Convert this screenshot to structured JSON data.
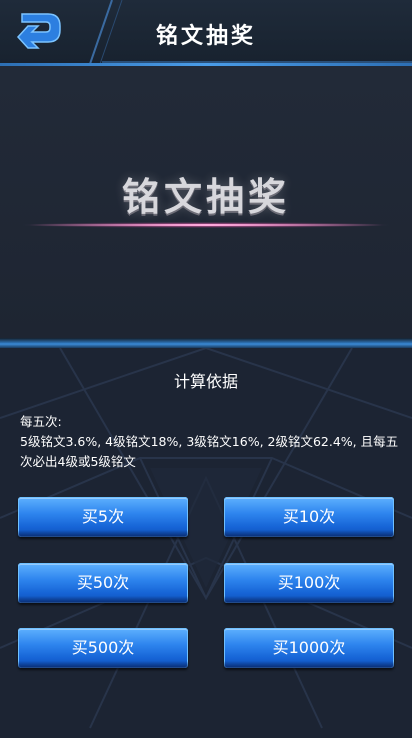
{
  "header": {
    "title": "铭文抽奖",
    "back_icon": "back-arrow-icon"
  },
  "banner": {
    "title": "铭文抽奖"
  },
  "section": {
    "title": "计算依据",
    "desc_line1": "每五次:",
    "desc_line2": "5级铭文3.6%, 4级铭文18%, 3级铭文16%, 2级铭文62.4%, 且每五次必出4级或5级铭文"
  },
  "buttons": {
    "buy5": "买5次",
    "buy10": "买10次",
    "buy50": "买50次",
    "buy100": "买100次",
    "buy500": "买500次",
    "buy1000": "买1000次"
  },
  "colors": {
    "accent_blue": "#2f86ef",
    "background": "#1c2330",
    "banner_glow": "#ff9ad0"
  }
}
